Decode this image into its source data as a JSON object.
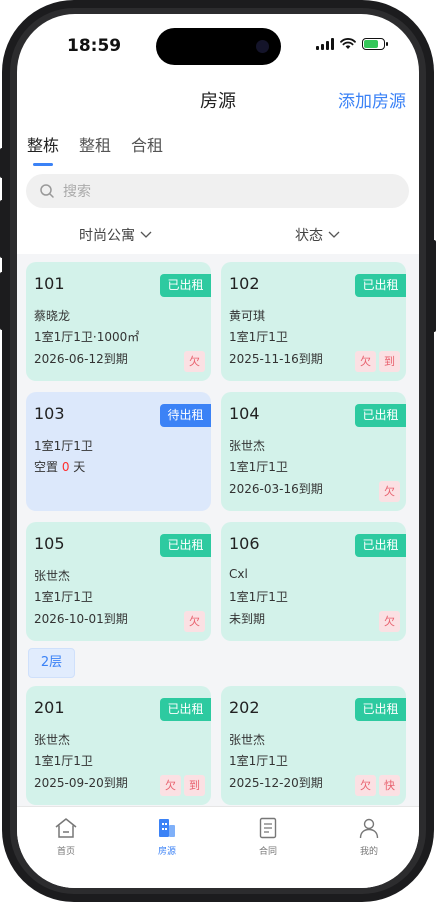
{
  "status_bar": {
    "time": "18:59"
  },
  "nav": {
    "title": "房源",
    "action": "添加房源"
  },
  "tabs": [
    {
      "label": "整栋",
      "active": true
    },
    {
      "label": "整租",
      "active": false
    },
    {
      "label": "合租",
      "active": false
    }
  ],
  "search": {
    "placeholder": "搜索"
  },
  "filters": {
    "building": "时尚公寓",
    "status": "状态"
  },
  "floors": [
    {
      "label": "",
      "units": [
        {
          "room": "101",
          "status": "已出租",
          "lines": [
            "蔡晓龙",
            "1室1厅1卫·1000㎡",
            "2026-06-12到期"
          ],
          "tags": [
            "欠"
          ]
        },
        {
          "room": "102",
          "status": "已出租",
          "lines": [
            "黄可琪",
            "1室1厅1卫",
            "2025-11-16到期"
          ],
          "tags": [
            "欠",
            "到"
          ]
        },
        {
          "room": "103",
          "status": "待出租",
          "lines": [
            "1室1厅1卫"
          ],
          "vacancy": {
            "prefix": "空置 ",
            "days": "0",
            "suffix": " 天"
          },
          "tags": []
        },
        {
          "room": "104",
          "status": "已出租",
          "lines": [
            "张世杰",
            "1室1厅1卫",
            "2026-03-16到期"
          ],
          "tags": [
            "欠"
          ]
        },
        {
          "room": "105",
          "status": "已出租",
          "lines": [
            "张世杰",
            "1室1厅1卫",
            "2026-10-01到期"
          ],
          "tags": [
            "欠"
          ]
        },
        {
          "room": "106",
          "status": "已出租",
          "lines": [
            "Cxl",
            "1室1厅1卫",
            "未到期"
          ],
          "tags": [
            "欠"
          ]
        }
      ]
    },
    {
      "label": "2层",
      "units": [
        {
          "room": "201",
          "status": "已出租",
          "lines": [
            "张世杰",
            "1室1厅1卫",
            "2025-09-20到期"
          ],
          "tags": [
            "欠",
            "到"
          ]
        },
        {
          "room": "202",
          "status": "已出租",
          "lines": [
            "张世杰",
            "1室1厅1卫",
            "2025-12-20到期"
          ],
          "tags": [
            "欠",
            "快"
          ]
        }
      ]
    }
  ],
  "tab_bar": [
    {
      "label": "首页",
      "icon": "home-icon",
      "active": false
    },
    {
      "label": "房源",
      "icon": "building-icon",
      "active": true
    },
    {
      "label": "合同",
      "icon": "contract-icon",
      "active": false
    },
    {
      "label": "我的",
      "icon": "profile-icon",
      "active": false
    }
  ],
  "colors": {
    "accent": "#3b82f6",
    "rented": "#2dcaa0",
    "card_rented": "#d3f2ea",
    "card_vacant": "#dce8fb",
    "tag_text": "#e8616e"
  }
}
